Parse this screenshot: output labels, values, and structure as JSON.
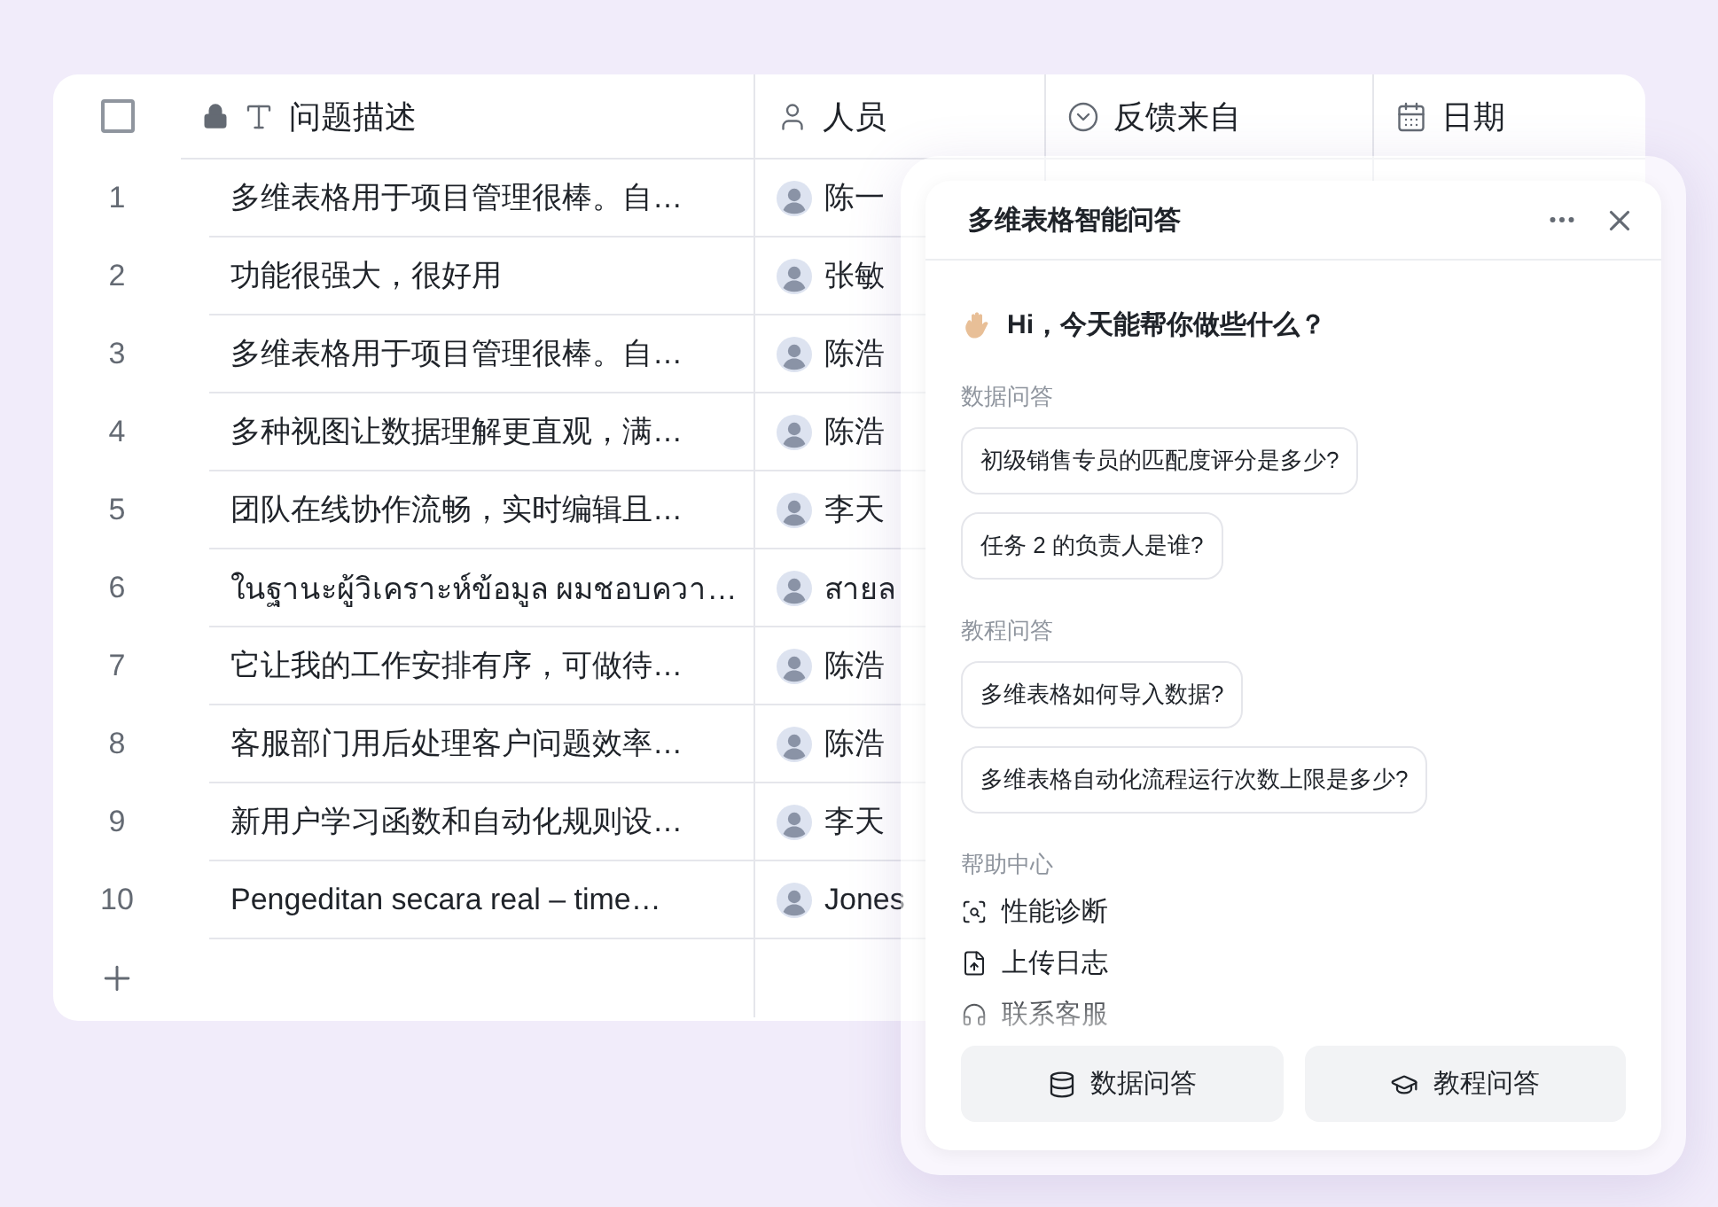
{
  "table": {
    "columns": [
      {
        "label": "问题描述",
        "kind": "text",
        "locked": true
      },
      {
        "label": "人员",
        "kind": "person",
        "locked": false
      },
      {
        "label": "反馈来自",
        "kind": "select",
        "locked": false
      },
      {
        "label": "日期",
        "kind": "date",
        "locked": false
      }
    ],
    "select_all": {
      "checked": false
    },
    "rows": [
      {
        "index": "1",
        "description": "多维表格用于项目管理很棒。自…",
        "person": "陈一"
      },
      {
        "index": "2",
        "description": "功能很强大，很好用",
        "person": "张敏"
      },
      {
        "index": "3",
        "description": "多维表格用于项目管理很棒。自…",
        "person": "陈浩"
      },
      {
        "index": "4",
        "description": "多种视图让数据理解更直观，满…",
        "person": "陈浩"
      },
      {
        "index": "5",
        "description": "团队在线协作流畅，实时编辑且…",
        "person": "李天"
      },
      {
        "index": "6",
        "description": "ในฐานะผู้วิเคราะห์ข้อมูล ผมชอบควา…",
        "person": "สายล"
      },
      {
        "index": "7",
        "description": "它让我的工作安排有序，可做待…",
        "person": "陈浩"
      },
      {
        "index": "8",
        "description": "客服部门用后处理客户问题效率…",
        "person": "陈浩"
      },
      {
        "index": "9",
        "description": "新用户学习函数和自动化规则设…",
        "person": "李天"
      },
      {
        "index": "10",
        "description": "Pengeditan secara real – time…",
        "person": "Jones"
      }
    ]
  },
  "assistant": {
    "title": "多维表格智能问答",
    "greeting": "Hi，今天能帮你做些什么？",
    "sections": [
      {
        "label": "数据问答",
        "questions": [
          "初级销售专员的匹配度评分是多少?",
          "任务 2 的负责人是谁?"
        ]
      },
      {
        "label": "教程问答",
        "questions": [
          "多维表格如何导入数据?",
          "多维表格自动化流程运行次数上限是多少?"
        ]
      }
    ],
    "help": {
      "label": "帮助中心",
      "items": [
        {
          "label": "性能诊断",
          "kind": "diagnose"
        },
        {
          "label": "上传日志",
          "kind": "upload"
        },
        {
          "label": "联系客服",
          "kind": "contact"
        }
      ]
    },
    "buttons": [
      {
        "label": "数据问答",
        "kind": "data"
      },
      {
        "label": "教程问答",
        "kind": "tutorial"
      }
    ]
  }
}
